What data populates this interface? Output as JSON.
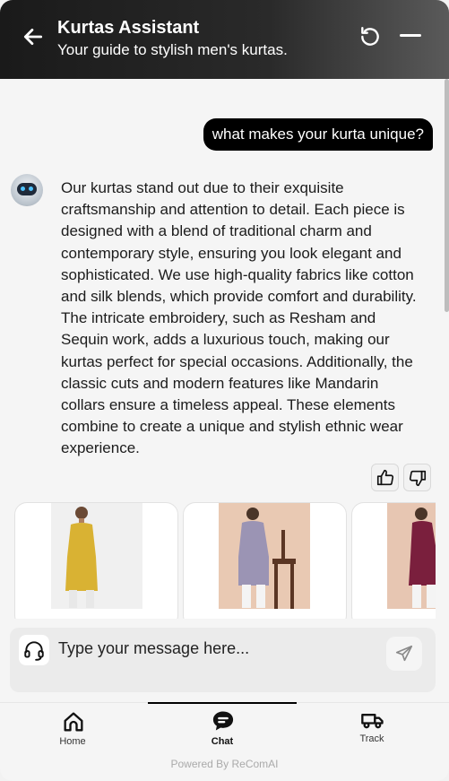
{
  "header": {
    "title": "Kurtas Assistant",
    "subtitle": "Your guide to stylish men's kurtas."
  },
  "chat": {
    "user_message": "what makes your kurta unique?",
    "bot_message": "Our kurtas stand out due to their exquisite craftsmanship and attention to detail. Each piece is designed with a blend of traditional charm and contemporary style, ensuring you look elegant and sophisticated. We use high-quality fabrics like cotton and silk blends, which provide comfort and durability. The intricate embroidery, such as Resham and Sequin work, adds a luxurious touch, making our kurtas perfect for special occasions. Additionally, the classic cuts and modern features like Mandarin collars ensure a timeless appeal. These elements combine to create a unique and stylish ethnic wear experience."
  },
  "products": [
    {
      "image": "mustard kurta",
      "bg": "#f0f0f0"
    },
    {
      "image": "lavender kurta",
      "bg": "#e9c9b3"
    },
    {
      "image": "maroon kurta",
      "bg": "#e7c6b2"
    }
  ],
  "composer": {
    "placeholder": "Type your message here..."
  },
  "nav": {
    "home": "Home",
    "chat": "Chat",
    "track": "Track"
  },
  "footer": {
    "powered": "Powered By ReComAI"
  },
  "colors": {
    "header_dark": "#1a1a1a",
    "bubble": "#000000",
    "accent": "#000000"
  }
}
